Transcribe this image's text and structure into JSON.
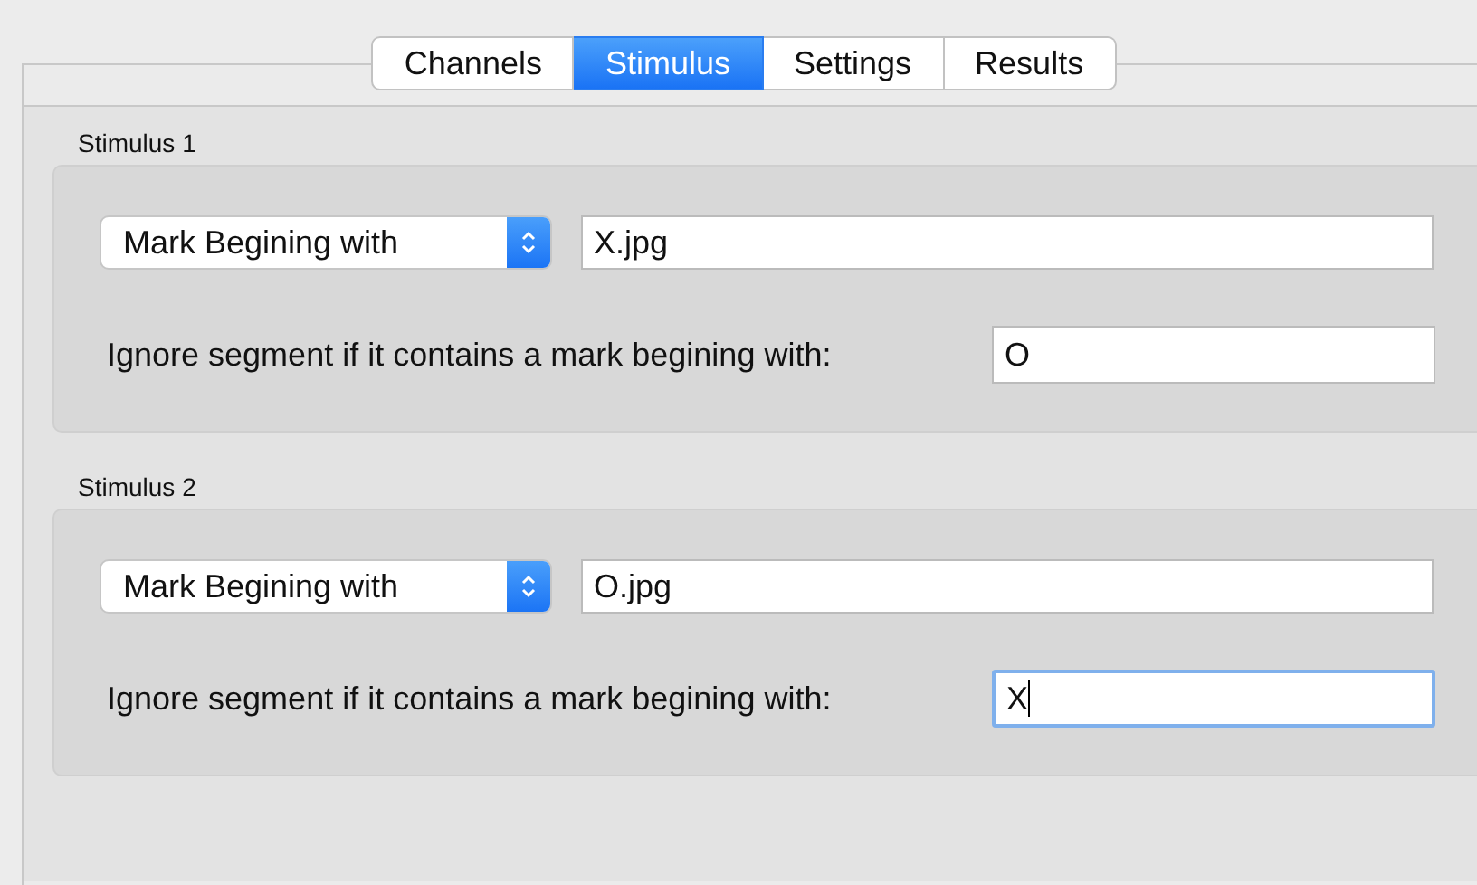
{
  "tabs": [
    {
      "label": "Channels",
      "selected": false
    },
    {
      "label": "Stimulus",
      "selected": true
    },
    {
      "label": "Settings",
      "selected": false
    },
    {
      "label": "Results",
      "selected": false
    }
  ],
  "groups": [
    {
      "title": "Stimulus 1",
      "popup": "Mark Begining with",
      "mark_value": "X.jpg",
      "ignore_label": "Ignore segment if it contains a mark begining with:",
      "ignore_value": "O",
      "ignore_focused": false
    },
    {
      "title": "Stimulus 2",
      "popup": "Mark Begining with",
      "mark_value": "O.jpg",
      "ignore_label": "Ignore segment if it contains a mark begining with:",
      "ignore_value": "X",
      "ignore_focused": true
    }
  ]
}
